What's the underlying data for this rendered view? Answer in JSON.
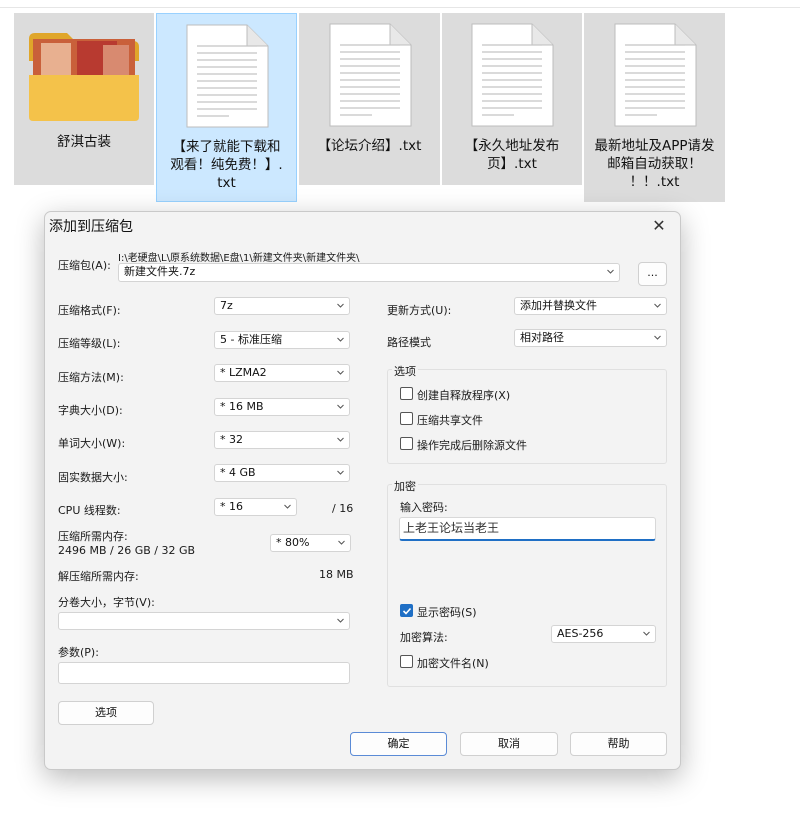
{
  "files": [
    {
      "name": "舒淇古装",
      "type": "folder"
    },
    {
      "name": "【来了就能下载和观看！纯免费！】.txt",
      "lines": [
        "【来了就能下载和",
        "观看！纯免费！】.",
        "txt"
      ],
      "type": "text-file",
      "selected": true
    },
    {
      "name": "【论坛介绍】.txt",
      "lines": [
        "【论坛介绍】.txt"
      ],
      "type": "text-file"
    },
    {
      "name": "【永久地址发布页】.txt",
      "lines": [
        "【永久地址发布",
        "页】.txt"
      ],
      "type": "text-file"
    },
    {
      "name": "最新地址及APP请发邮箱自动获取！！！.txt",
      "lines": [
        "最新地址及APP请发",
        "邮箱自动获取！",
        "！！.txt"
      ],
      "type": "text-file"
    }
  ],
  "dialog": {
    "title": "添加到压缩包",
    "close_icon": "close-icon",
    "archive_label": "压缩包(A):",
    "archive_path": "I:\\老硬盘\\L\\原系统数据\\E盘\\1\\新建文件夹\\新建文件夹\\",
    "archive_name": "新建文件夹.7z",
    "browse_label": "...",
    "format_label": "压缩格式(F):",
    "format_value": "7z",
    "level_label": "压缩等级(L):",
    "level_value": "5 - 标准压缩",
    "method_label": "压缩方法(M):",
    "method_value": "* LZMA2",
    "dict_label": "字典大小(D):",
    "dict_value": "* 16 MB",
    "word_label": "单词大小(W):",
    "word_value": "* 32",
    "solid_label": "固实数据大小:",
    "solid_value": "* 4 GB",
    "cpu_label": "CPU 线程数:",
    "cpu_value": "* 16",
    "cpu_total": "/ 16",
    "mem_label": "压缩所需内存:",
    "mem_value": "2496 MB / 26 GB / 32 GB",
    "mem_percent": "* 80%",
    "decomp_label": "解压缩所需内存:",
    "decomp_value": "18 MB",
    "volume_label": "分卷大小，字节(V):",
    "volume_value": "",
    "params_label": "参数(P):",
    "params_value": "",
    "options_button": "选项",
    "update_label": "更新方式(U):",
    "update_value": "添加并替换文件",
    "path_label": "路径模式",
    "path_value": "相对路径",
    "options_group": "选项",
    "opt_sfx": "创建自释放程序(X)",
    "opt_shared": "压缩共享文件",
    "opt_delete": "操作完成后删除源文件",
    "encrypt_group": "加密",
    "password_label": "输入密码:",
    "password_value": "上老王论坛当老王",
    "show_password": "显示密码(S)",
    "show_password_checked": true,
    "enc_method_label": "加密算法:",
    "enc_method_value": "AES-256",
    "encrypt_names": "加密文件名(N)",
    "ok_button": "确定",
    "cancel_button": "取消",
    "help_button": "帮助"
  },
  "colors": {
    "accent": "#1f6fc5",
    "selected_bg": "#cce8ff",
    "folder": "#f4c24a"
  }
}
